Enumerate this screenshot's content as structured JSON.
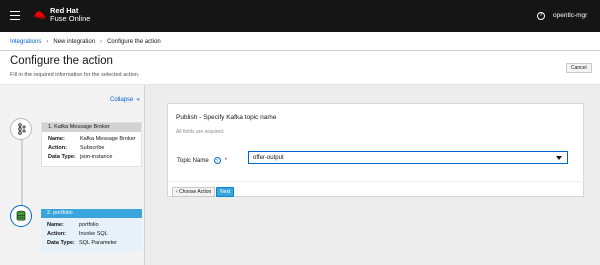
{
  "masthead": {
    "brand": "Red Hat",
    "product": "Fuse Online",
    "help_icon": "help-icon",
    "user": "opentlc-mgr"
  },
  "breadcrumb": {
    "items": [
      "Integrations",
      "New integration",
      "Configure the action"
    ]
  },
  "page": {
    "title": "Configure the action",
    "subtitle": "Fill in the required information for the selected action.",
    "cancel_label": "Cancel"
  },
  "steps": {
    "collapse_label": "Collapse",
    "collapse_icon": "double-chevron-left-icon",
    "list": [
      {
        "title": "1. Kafka Message Broker",
        "icon": "kafka-icon",
        "rows": [
          {
            "k": "Name:",
            "v": "Kafka Message Broker"
          },
          {
            "k": "Action:",
            "v": "Subscribe"
          },
          {
            "k": "Data Type:",
            "v": "json-instance"
          }
        ]
      },
      {
        "title": "2. portfolio",
        "icon": "database-icon",
        "rows": [
          {
            "k": "Name:",
            "v": "portfolio"
          },
          {
            "k": "Action:",
            "v": "Invoke SQL"
          },
          {
            "k": "Data Type:",
            "v": "SQL Parameter"
          }
        ]
      }
    ]
  },
  "form": {
    "title": "Publish - Specify Kafka topic name",
    "note": "All fields are required.",
    "field_label": "Topic Name",
    "required_mark": "*",
    "topic_value": "offer-output",
    "back_label": "‹ Choose Action",
    "next_label": "Next"
  },
  "colors": {
    "masthead": "#151515",
    "link": "#0066cc",
    "active_step": "#39a5dc",
    "required": "#c9190b"
  }
}
